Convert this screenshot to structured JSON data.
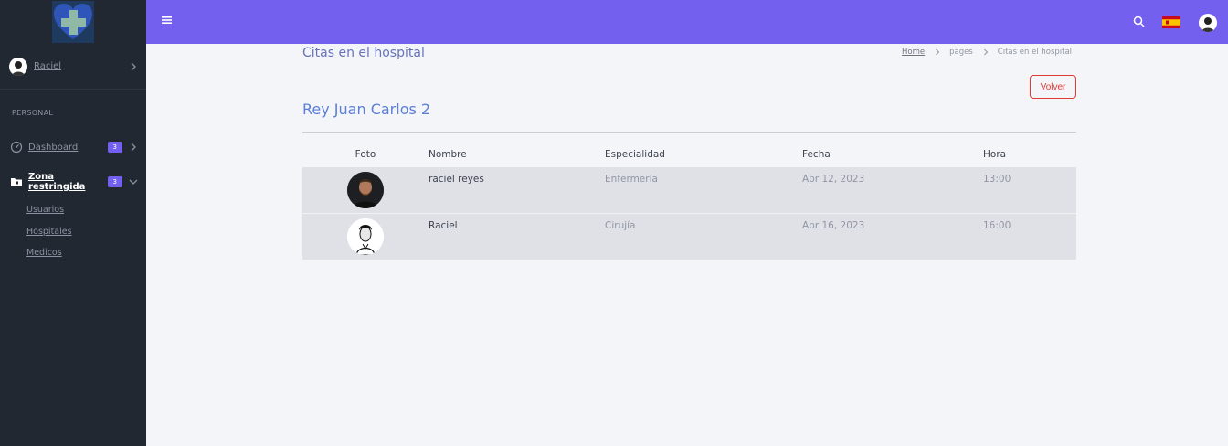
{
  "sidebar": {
    "user_name": "Raciel",
    "section_label": "PERSONAL",
    "nav": [
      {
        "label": "Dashboard",
        "badge": "3"
      },
      {
        "label": "Zona restringida",
        "badge": "3"
      }
    ],
    "sub_items": [
      "Usuarios",
      "Hospitales",
      "Medicos"
    ]
  },
  "topbar": {
    "flag_icon": "spain-flag-icon"
  },
  "page": {
    "title": "Citas en el hospital",
    "breadcrumb": [
      "Home",
      "pages",
      "Citas en el hospital"
    ],
    "back_label": "Volver",
    "hospital_name": "Rey Juan Carlos 2"
  },
  "table": {
    "headers": [
      "Foto",
      "Nombre",
      "Especialidad",
      "Fecha",
      "Hora"
    ],
    "rows": [
      {
        "nombre": "raciel reyes",
        "especialidad": "Enfermería",
        "fecha": "Apr 12, 2023",
        "hora": "13:00"
      },
      {
        "nombre": "Raciel",
        "especialidad": "Cirujía",
        "fecha": "Apr 16, 2023",
        "hora": "16:00"
      }
    ]
  },
  "colors": {
    "accent": "#7460ee",
    "sidebar": "#222831",
    "danger": "#e53935",
    "title": "#5b7fd6"
  }
}
